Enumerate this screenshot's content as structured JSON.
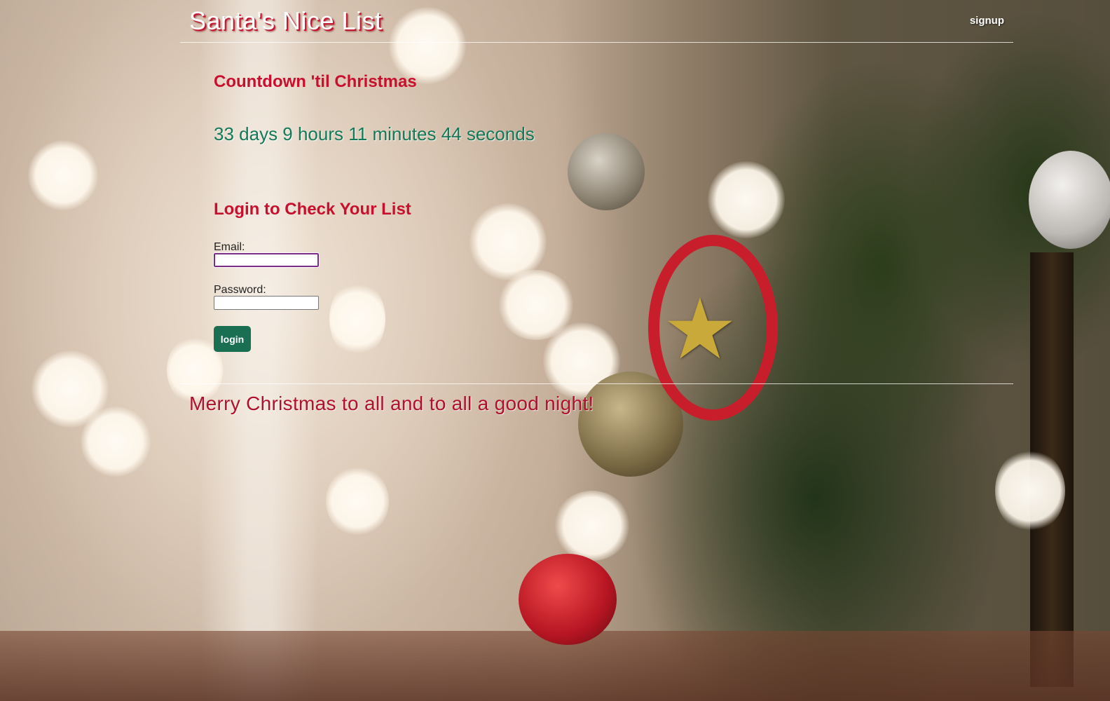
{
  "header": {
    "site_title": "Santa's Nice List",
    "signup_label": "signup"
  },
  "countdown": {
    "heading": "Countdown 'til Christmas",
    "value": "33 days 9 hours 11 minutes 44 seconds"
  },
  "login": {
    "heading": "Login to Check Your List",
    "email_label": "Email:",
    "email_value": "",
    "password_label": "Password:",
    "password_value": "",
    "button_label": "login"
  },
  "footer": {
    "message": "Merry Christmas to all and to all a good night!"
  },
  "colors": {
    "heading_red": "#c8102e",
    "countdown_green": "#137858",
    "button_green": "#1a6e52",
    "footer_red": "#b0102c"
  }
}
